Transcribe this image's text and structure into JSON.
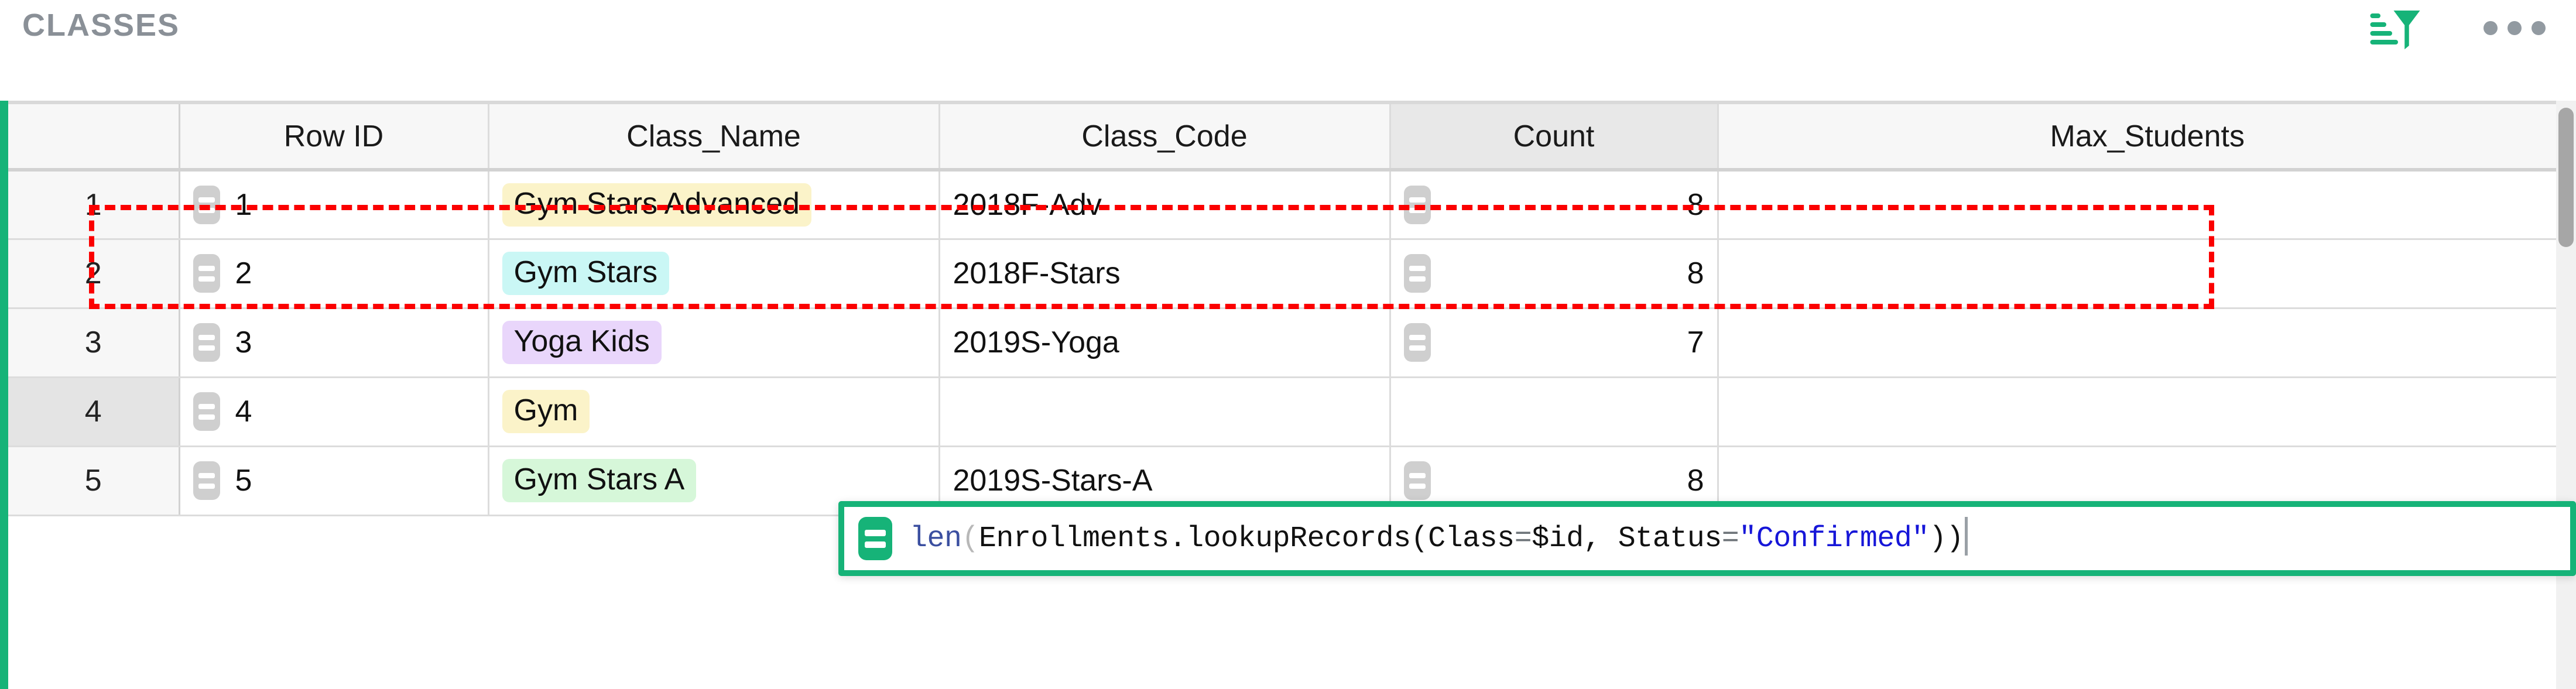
{
  "section": {
    "title": "CLASSES",
    "accent_color": "#16b378",
    "sort_filter_icon": "sort-filter-icon",
    "menu_icon": "more-options-icon"
  },
  "table": {
    "columns": [
      {
        "key": "rownum",
        "label": ""
      },
      {
        "key": "rowid",
        "label": "Row ID"
      },
      {
        "key": "name",
        "label": "Class_Name"
      },
      {
        "key": "code",
        "label": "Class_Code"
      },
      {
        "key": "count",
        "label": "Count"
      },
      {
        "key": "max",
        "label": "Max_Students"
      }
    ],
    "selected_column": "Count",
    "active_row": 4,
    "rows": [
      {
        "rownum": "1",
        "rowid": "1",
        "has_rowid_formula": true,
        "name": "Gym Stars Advanced",
        "name_chip": "yellow",
        "code": "2018F-Adv",
        "count": "8",
        "has_count_formula": true,
        "max": ""
      },
      {
        "rownum": "2",
        "rowid": "2",
        "has_rowid_formula": true,
        "name": "Gym Stars",
        "name_chip": "cyan",
        "code": "2018F-Stars",
        "count": "8",
        "has_count_formula": true,
        "max": ""
      },
      {
        "rownum": "3",
        "rowid": "3",
        "has_rowid_formula": true,
        "name": "Yoga Kids",
        "name_chip": "purple",
        "code": "2019S-Yoga",
        "count": "7",
        "has_count_formula": true,
        "max": ""
      },
      {
        "rownum": "4",
        "rowid": "4",
        "has_rowid_formula": true,
        "name": "Gym",
        "name_chip": "yellow",
        "code": "",
        "count": "",
        "has_count_formula": false,
        "max": ""
      },
      {
        "rownum": "5",
        "rowid": "5",
        "has_rowid_formula": true,
        "name": "Gym Stars A",
        "name_chip": "green",
        "code": "2019S-Stars-A",
        "count": "8",
        "has_count_formula": true,
        "max": ""
      }
    ]
  },
  "formula_editor": {
    "icon": "formula-equals-icon",
    "border_color": "#16b378",
    "tokens": [
      {
        "text": "len",
        "style": "fn"
      },
      {
        "text": "(",
        "style": "paren"
      },
      {
        "text": "Enrollments.lookupRecords(Class",
        "style": "plain"
      },
      {
        "text": "=",
        "style": "eq"
      },
      {
        "text": "$id, Status",
        "style": "plain"
      },
      {
        "text": "=",
        "style": "eq"
      },
      {
        "text": "\"Confirmed\"",
        "style": "str"
      },
      {
        "text": "))",
        "style": "plain"
      }
    ],
    "full_text": "len(Enrollments.lookupRecords(Class=$id, Status=\"Confirmed\"))",
    "caret_visible": true
  },
  "annotation": {
    "type": "red-dashed-rectangle",
    "color": "#fb0000",
    "targets_row": "2"
  },
  "scrollbar": {
    "orientation": "vertical",
    "position": "top"
  }
}
